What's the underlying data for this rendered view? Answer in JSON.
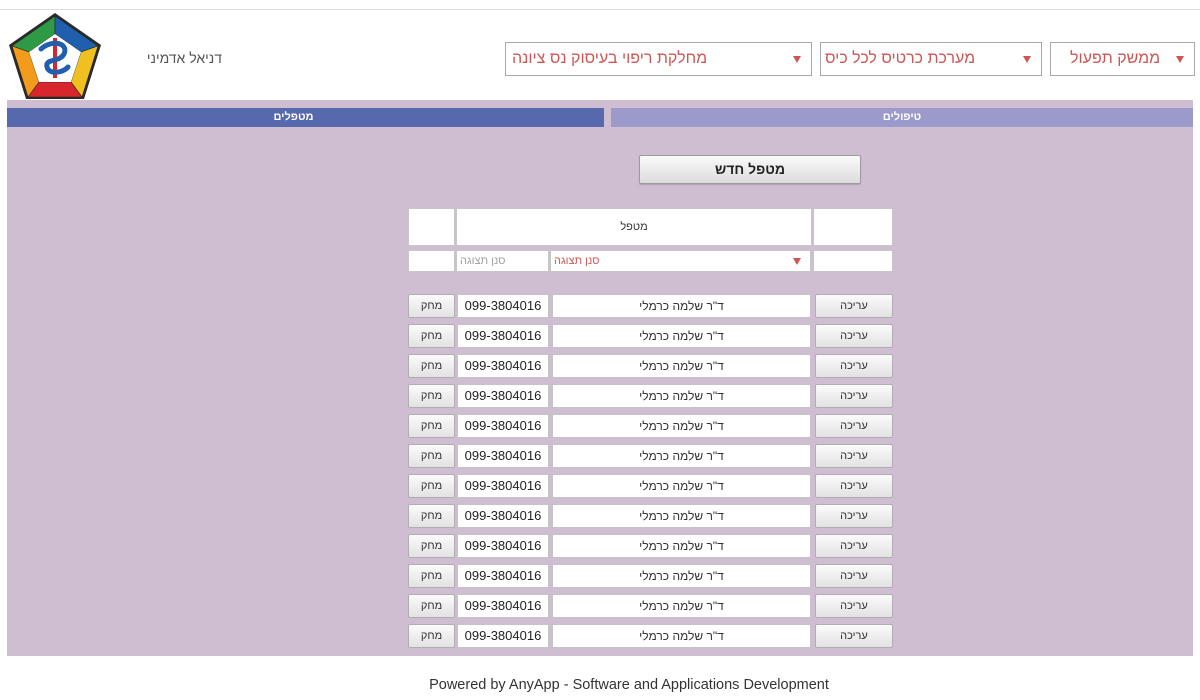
{
  "header": {
    "user_name": "דניאל אדמיני",
    "department_select": "מחלקת ריפוי בעיסוק נס ציונה",
    "system_select": "מערכת כרטיס לכל כיס",
    "interface_select": "ממשק תפעול"
  },
  "tabs": [
    {
      "label": "מטפלים",
      "active": true
    },
    {
      "label": "טיפולים",
      "active": false
    }
  ],
  "main": {
    "new_button_label": "מטפל חדש",
    "table": {
      "column_header": "מטפל",
      "filter_input_placeholder": "סנן תצוגה",
      "filter_select_value": "סנן תצוגה",
      "delete_label": "מחק",
      "edit_label": "עריכה",
      "rows": [
        {
          "name": "ד\"ר שלמה כרמלי",
          "phone": "099-3804016"
        },
        {
          "name": "ד\"ר שלמה כרמלי",
          "phone": "099-3804016"
        },
        {
          "name": "ד\"ר שלמה כרמלי",
          "phone": "099-3804016"
        },
        {
          "name": "ד\"ר שלמה כרמלי",
          "phone": "099-3804016"
        },
        {
          "name": "ד\"ר שלמה כרמלי",
          "phone": "099-3804016"
        },
        {
          "name": "ד\"ר שלמה כרמלי",
          "phone": "099-3804016"
        },
        {
          "name": "ד\"ר שלמה כרמלי",
          "phone": "099-3804016"
        },
        {
          "name": "ד\"ר שלמה כרמלי",
          "phone": "099-3804016"
        },
        {
          "name": "ד\"ר שלמה כרמלי",
          "phone": "099-3804016"
        },
        {
          "name": "ד\"ר שלמה כרמלי",
          "phone": "099-3804016"
        },
        {
          "name": "ד\"ר שלמה כרמלי",
          "phone": "099-3804016"
        },
        {
          "name": "ד\"ר שלמה כרמלי",
          "phone": "099-3804016"
        }
      ]
    }
  },
  "footer": {
    "text": "Powered by AnyApp - Software and Applications Development"
  },
  "colors": {
    "content_background": "#cfbdd1",
    "tab_active": "#5669ad",
    "tab_inactive": "#9b9acb",
    "select_text": "#cf5656"
  },
  "icons": {
    "dropdown": "dropdown-arrow-icon",
    "logo": "medical-emblem-logo"
  }
}
